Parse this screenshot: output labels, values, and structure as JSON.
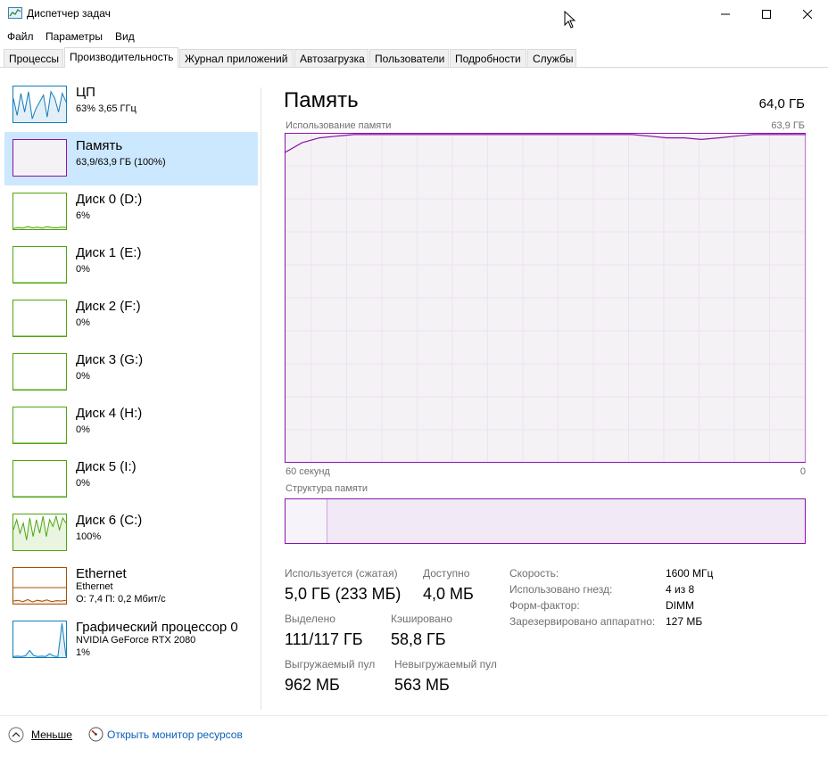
{
  "window": {
    "title": "Диспетчер задач"
  },
  "menu": [
    "Файл",
    "Параметры",
    "Вид"
  ],
  "tabs": [
    "Процессы",
    "Производительность",
    "Журнал приложений",
    "Автозагрузка",
    "Пользователи",
    "Подробности",
    "Службы"
  ],
  "active_tab": "Производительность",
  "sidebar": [
    {
      "title": "ЦП",
      "sub": "63% 3,65 ГГц",
      "sub2": "",
      "color": "#117dbb"
    },
    {
      "title": "Память",
      "sub": "63,9/63,9 ГБ (100%)",
      "sub2": "",
      "color": "#8b12ae"
    },
    {
      "title": "Диск 0 (D:)",
      "sub": "6%",
      "sub2": "",
      "color": "#4da60c"
    },
    {
      "title": "Диск 1 (E:)",
      "sub": "0%",
      "sub2": "",
      "color": "#4da60c"
    },
    {
      "title": "Диск 2 (F:)",
      "sub": "0%",
      "sub2": "",
      "color": "#4da60c"
    },
    {
      "title": "Диск 3 (G:)",
      "sub": "0%",
      "sub2": "",
      "color": "#4da60c"
    },
    {
      "title": "Диск 4 (H:)",
      "sub": "0%",
      "sub2": "",
      "color": "#4da60c"
    },
    {
      "title": "Диск 5 (I:)",
      "sub": "0%",
      "sub2": "",
      "color": "#4da60c"
    },
    {
      "title": "Диск 6 (C:)",
      "sub": "100%",
      "sub2": "",
      "color": "#4da60c"
    },
    {
      "title": "Ethernet",
      "sub": "Ethernet",
      "sub2": "О: 7,4 П: 0,2 Мбит/с",
      "color": "#a74f01"
    },
    {
      "title": "Графический процессор 0",
      "sub": "NVIDIA GeForce RTX 2080",
      "sub2": "1%",
      "color": "#117dbb"
    }
  ],
  "memory": {
    "title": "Память",
    "total": "64,0 ГБ",
    "usage_label": "Использование памяти",
    "usage_max": "63,9 ГБ",
    "axis_left": "60 секунд",
    "axis_right": "0",
    "structure_label": "Структура памяти",
    "structure_used_fraction": 0.08,
    "stats": {
      "in_use_label": "Используется (сжатая)",
      "in_use_value": "5,0 ГБ (233 МБ)",
      "available_label": "Доступно",
      "available_value": "4,0 МБ",
      "committed_label": "Выделено",
      "committed_value": "111/117 ГБ",
      "cached_label": "Кэшировано",
      "cached_value": "58,8 ГБ",
      "paged_label": "Выгружаемый пул",
      "paged_value": "962 МБ",
      "nonpaged_label": "Невыгружаемый пул",
      "nonpaged_value": "563 МБ"
    },
    "specs": [
      {
        "label": "Скорость:",
        "value": "1600 МГц"
      },
      {
        "label": "Использовано гнезд:",
        "value": "4 из 8"
      },
      {
        "label": "Форм-фактор:",
        "value": "DIMM"
      },
      {
        "label": "Зарезервировано аппаратно:",
        "value": "127 МБ"
      }
    ],
    "colors": {
      "line": "#8b12ae",
      "grid": "#f0e0f5",
      "fill": "#f4f2f4"
    }
  },
  "bottom": {
    "fewer_label": "Меньше",
    "resmon_link": "Открыть монитор ресурсов"
  }
}
